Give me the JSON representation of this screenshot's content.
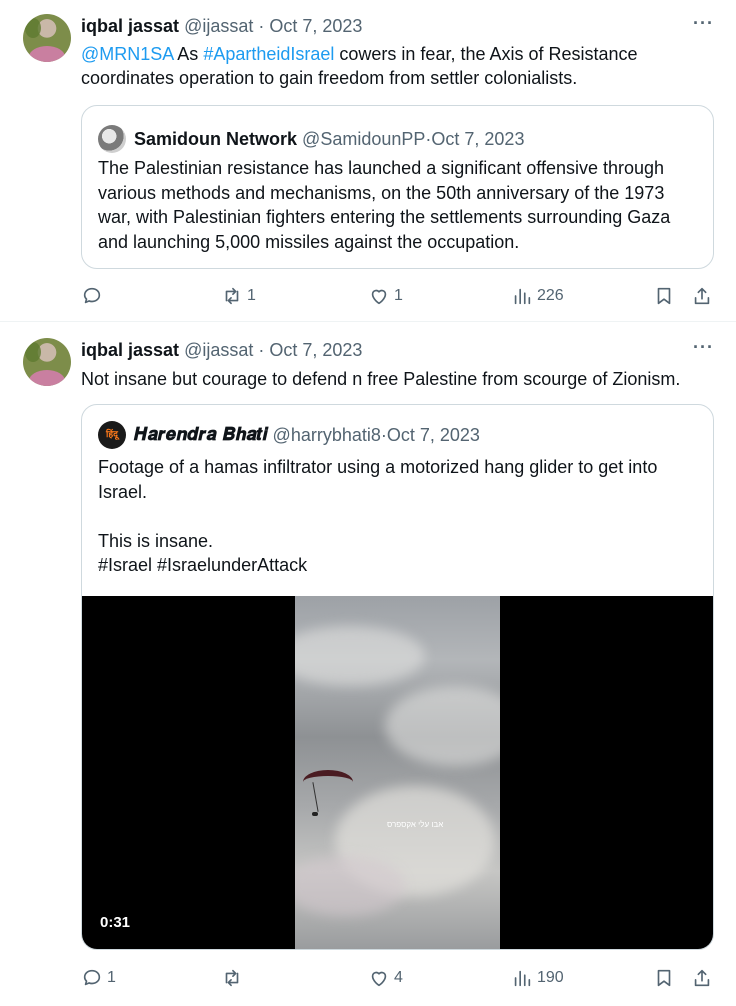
{
  "tweets": [
    {
      "author": "iqbal jassat",
      "handle": "@ijassat",
      "date": "Oct 7, 2023",
      "more": "···",
      "text_mention": "@MRN1SA",
      "text_space1": " As ",
      "text_hashtag": "#ApartheidIsrael",
      "text_rest": " cowers in fear, the Axis of Resistance coordinates operation to gain freedom from settler colonialists.",
      "quote": {
        "author": "Samidoun Network",
        "handle": "@SamidounPP",
        "date": "Oct 7, 2023",
        "text": "The Palestinian resistance has launched a significant offensive through various methods and mechanisms, on the 50th anniversary of the 1973 war, with Palestinian fighters entering the settlements surrounding Gaza and launching 5,000 missiles against the occupation."
      },
      "actions": {
        "replies": "",
        "reposts": "1",
        "likes": "1",
        "views": "226"
      }
    },
    {
      "author": "iqbal jassat",
      "handle": "@ijassat",
      "date": "Oct 7, 2023",
      "more": "···",
      "text": "Not insane but courage to defend n free Palestine from scourge of Zionism.",
      "quote": {
        "author": "𝑯𝒂𝒓𝒆𝒏𝒅𝒓𝒂 𝑩𝒉𝒂𝒕𝒊",
        "avatar_text": "हिंदू",
        "handle": "@harrybhati8",
        "date": "Oct 7, 2023",
        "text": "Footage of a hamas infiltrator using a motorized hang glider to get into Israel.\n\nThis is insane.\n#Israel  #IsraelunderAttack",
        "video_caption": "אבו עלי אקספרס",
        "video_duration": "0:31"
      },
      "actions": {
        "replies": "1",
        "reposts": "",
        "likes": "4",
        "views": "190"
      }
    }
  ],
  "meta_separator": " · ",
  "colors": {
    "link": "#1d9bf0",
    "muted": "#536471",
    "border": "#cfd9de"
  },
  "icons": [
    "reply-icon",
    "repost-icon",
    "like-icon",
    "views-icon",
    "bookmark-icon",
    "share-icon",
    "more-icon"
  ]
}
